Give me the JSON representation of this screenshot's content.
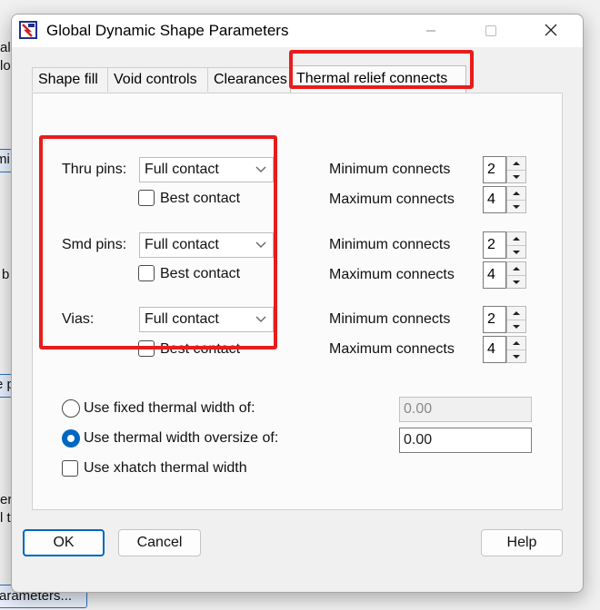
{
  "background": {
    "fragments": [
      "alle",
      "lo",
      "mi",
      "b",
      "e p",
      "er",
      "l t"
    ],
    "bottom_button": "arameters..."
  },
  "dialog": {
    "title": "Global Dynamic Shape Parameters",
    "tabs": [
      "Shape fill",
      "Void controls",
      "Clearances",
      "Thermal relief connects"
    ],
    "active_tab": "Thermal relief connects",
    "rows": [
      {
        "label": "Thru pins:",
        "value": "Full contact",
        "best_contact_label": "Best contact",
        "best_contact_checked": false,
        "min_label": "Minimum connects",
        "min_value": "2",
        "max_label": "Maximum connects",
        "max_value": "4"
      },
      {
        "label": "Smd pins:",
        "value": "Full contact",
        "best_contact_label": "Best contact",
        "best_contact_checked": false,
        "min_label": "Minimum connects",
        "min_value": "2",
        "max_label": "Maximum connects",
        "max_value": "4"
      },
      {
        "label": "Vias:",
        "value": "Full contact",
        "best_contact_label": "Best contact",
        "best_contact_checked": false,
        "min_label": "Minimum connects",
        "min_value": "2",
        "max_label": "Maximum connects",
        "max_value": "4"
      }
    ],
    "options": {
      "fixed_width_label": "Use fixed thermal width of:",
      "fixed_width_value": "0.00",
      "fixed_width_selected": false,
      "oversize_label": "Use thermal width oversize of:",
      "oversize_value": "0.00",
      "oversize_selected": true,
      "xhatch_label": "Use xhatch thermal width",
      "xhatch_checked": false
    },
    "buttons": {
      "ok": "OK",
      "cancel": "Cancel",
      "help": "Help"
    }
  },
  "colors": {
    "highlight": "#e81c1c",
    "accent": "#0067c0"
  }
}
